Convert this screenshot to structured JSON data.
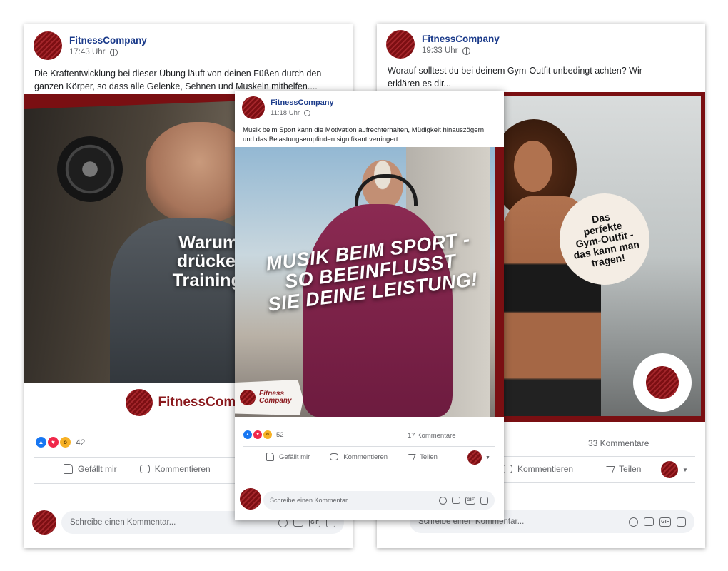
{
  "colors": {
    "brand": "#8b1a1e",
    "name": "#1a3a8a",
    "muted": "#65676b"
  },
  "post1": {
    "author": "FitnessCompany",
    "time": "17:43 Uhr",
    "text": "Die Kraftentwicklung bei dieser Übung läuft von deinen Füßen durch den ganzen Körper, so dass alle Gelenke, Sehnen und Muskeln mithelfen....",
    "headline": [
      "Warum Schult",
      "drücken in Dei",
      "Trainingsplan g"
    ],
    "brand_footer": "FitnessCompa",
    "reaction_count": "42",
    "actions": {
      "like": "Gefällt mir",
      "comment": "Kommentieren"
    },
    "comment_placeholder": "Schreibe einen Kommentar..."
  },
  "post2": {
    "author": "FitnessCompany",
    "time": "11:18 Uhr",
    "text": "Musik beim Sport kann die Motivation aufrechterhalten, Müdigkeit hinauszögern und das Belastungsempfinden signifikant verringert.",
    "headline": [
      "MUSIK BEIM SPORT -",
      "SO BEEINFLUSST",
      "SIE DEINE LEISTUNG!"
    ],
    "brand_badge": [
      "Fitness",
      "Company"
    ],
    "reaction_count": "52",
    "comments_count": "17 Kommentare",
    "actions": {
      "like": "Gefällt mir",
      "comment": "Kommentieren",
      "share": "Teilen"
    },
    "comment_placeholder": "Schreibe einen Kommentar..."
  },
  "post3": {
    "author": "FitnessCompany",
    "time": "19:33 Uhr",
    "text": "Worauf solltest du bei deinem Gym-Outfit unbedingt achten? Wir erklären es dir...",
    "bubble": [
      "Das",
      "perfekte",
      "Gym-Outfit -",
      "das kann man",
      "tragen!"
    ],
    "comments_count": "33 Kommentare",
    "actions": {
      "comment": "Kommentieren",
      "share": "Teilen"
    },
    "comment_placeholder": "Schreibe einen Kommentar..."
  }
}
